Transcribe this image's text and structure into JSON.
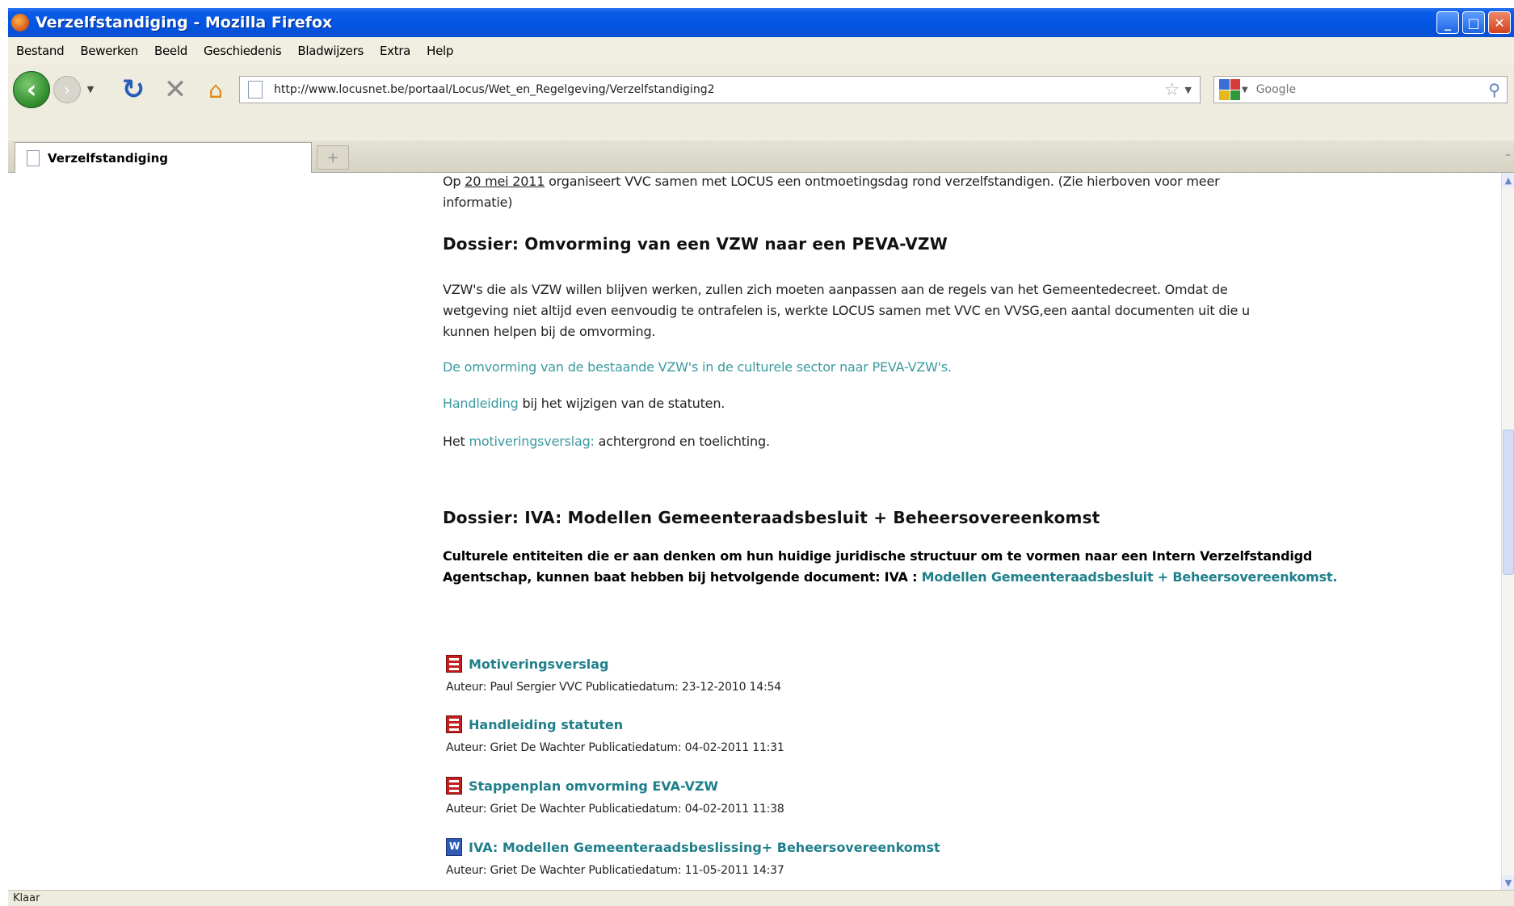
{
  "window": {
    "title": "Verzelfstandiging - Mozilla Firefox",
    "buttons": {
      "minimize": "_",
      "maximize": "□",
      "close": "✕"
    }
  },
  "menubar": {
    "items": [
      "Bestand",
      "Bewerken",
      "Beeld",
      "Geschiedenis",
      "Bladwijzers",
      "Extra",
      "Help"
    ]
  },
  "navbar": {
    "back_icon": "back-arrow-icon",
    "url": "http://www.locusnet.be/portaal/Locus/Wet_en_Regelgeving/Verzelfstandiging2",
    "search_placeholder": "Google"
  },
  "tabs": {
    "active_label": "Verzelfstandiging",
    "newtab_label": "+"
  },
  "article": {
    "intro_pre": "Op ",
    "intro_date": "20 mei 2011",
    "intro_post": " organiseert VVC samen met LOCUS een ontmoetingsdag rond verzelfstandigen. (Zie hierboven voor meer",
    "intro_line2": "informatie)",
    "h1": "Dossier: Omvorming van een VZW naar een PEVA-VZW",
    "p1_line1": "VZW's die als VZW willen blijven werken, zullen zich moeten aanpassen aan de regels van het Gemeentedecreet. Omdat de",
    "p1_line2": "wetgeving niet altijd even eenvoudig te ontrafelen is, werkte LOCUS samen met VVC en VVSG,een aantal documenten uit die u",
    "p1_line3": "kunnen helpen bij de omvorming.",
    "link1": "De omvorming van de bestaande VZW's in de culturele sector naar PEVA-VZW's.",
    "link2": "Handleiding",
    "link2_post": " bij het wijzigen van de statuten.",
    "link3_pre": "Het ",
    "link3": "motiveringsverslag:",
    "link3_post": " achtergrond en toelichting.",
    "h2": "Dossier: IVA: Modellen Gemeenteraadsbesluit + Beheersovereenkomst",
    "p2_line1": "Culturele entiteiten die er aan denken om hun huidige juridische structuur om te vormen naar een Intern Verzelfstandigd",
    "p2_line2": "Agentschap, kunnen baat hebben bij hetvolgende document: IVA : ",
    "p2_link": "Modellen Gemeenteraadsbesluit + Beheersovereenkomst."
  },
  "documents": [
    {
      "title": "Motiveringsverslag",
      "meta": "Auteur: Paul Sergier VVC Publicatiedatum: 23-12-2010 14:54",
      "icon": "pdf-icon"
    },
    {
      "title": "Handleiding statuten",
      "meta": "Auteur: Griet De Wachter Publicatiedatum: 04-02-2011 11:31",
      "icon": "pdf-icon"
    },
    {
      "title": "Stappenplan omvorming EVA-VZW",
      "meta": "Auteur: Griet De Wachter Publicatiedatum: 04-02-2011 11:38",
      "icon": "pdf-icon"
    },
    {
      "title": "IVA: Modellen Gemeenteraadsbeslissing+ Beheersovereenkomst",
      "meta": "Auteur: Griet De Wachter Publicatiedatum: 11-05-2011 14:37",
      "icon": "word-icon"
    }
  ],
  "status": {
    "text": "Klaar"
  },
  "colors": {
    "link": "#3a9aa0",
    "titlebar": "#0254e2"
  }
}
